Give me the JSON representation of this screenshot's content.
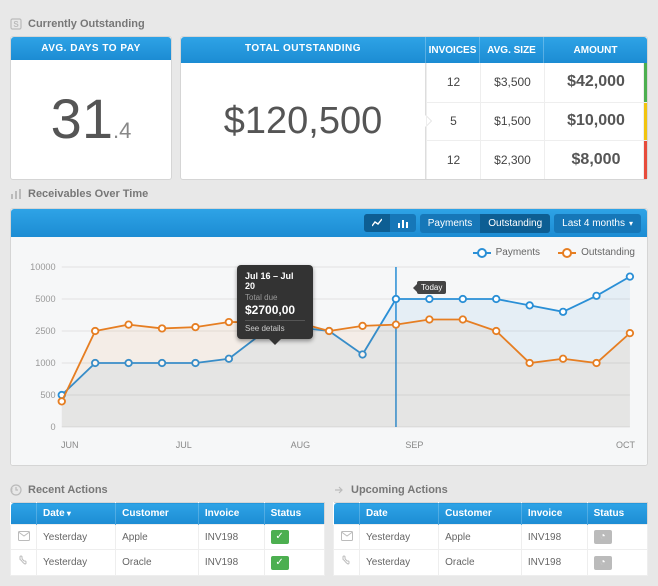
{
  "sections": {
    "outstanding_title": "Currently Outstanding",
    "receivables_title": "Receivables Over Time",
    "recent_title": "Recent Actions",
    "upcoming_title": "Upcoming Actions"
  },
  "avg_days": {
    "header": "AVG. DAYS TO PAY",
    "int": "31",
    "dec": ".4"
  },
  "total_outstanding": {
    "header": "TOTAL OUTSTANDING",
    "amount": "$120,500",
    "cols": {
      "invoices": "INVOICES",
      "avg_size": "AVG. SIZE",
      "amount": "AMOUNT"
    },
    "rows": [
      {
        "invoices": "12",
        "avg": "$3,500",
        "amount": "$42,000",
        "stripe": "#4caf50"
      },
      {
        "invoices": "5",
        "avg": "$1,500",
        "amount": "$10,000",
        "stripe": "#f1c40f"
      },
      {
        "invoices": "12",
        "avg": "$2,300",
        "amount": "$8,000",
        "stripe": "#e74c3c"
      }
    ]
  },
  "toolbar": {
    "btn_payments": "Payments",
    "btn_outstanding": "Outstanding",
    "range": "Last 4 months"
  },
  "legend": {
    "payments": "Payments",
    "outstanding": "Outstanding"
  },
  "tooltip": {
    "range": "Jul 16 – Jul 20",
    "label": "Total due",
    "value": "$2700,00",
    "link": "See details"
  },
  "today_label": "Today",
  "chart_data": {
    "type": "line",
    "xlabel": "",
    "ylabel": "",
    "y_ticks": [
      0,
      500,
      1000,
      2500,
      5000,
      10000
    ],
    "x_ticks": [
      "JUN",
      "JUL",
      "AUG",
      "SEP",
      "OCT"
    ],
    "x_domain_weeks": 17,
    "series": [
      {
        "name": "Payments",
        "color": "#2a8fd6",
        "values": [
          500,
          1000,
          1000,
          1000,
          1000,
          1200,
          2400,
          2800,
          2500,
          1400,
          5000,
          5000,
          5000,
          5000,
          4500,
          4000,
          5500,
          8500
        ]
      },
      {
        "name": "Outstanding",
        "color": "#e67e22",
        "values": [
          400,
          2500,
          3000,
          2700,
          2800,
          3200,
          3200,
          3200,
          2500,
          2900,
          3000,
          3400,
          3400,
          2500,
          1000,
          1200,
          1000,
          2400
        ]
      }
    ],
    "today_marker_index": 10,
    "tooltip_index": 7
  },
  "tables": {
    "cols": {
      "date": "Date",
      "customer": "Customer",
      "invoice": "Invoice",
      "status": "Status"
    },
    "recent": [
      {
        "icon": "mail",
        "date": "Yesterday",
        "customer": "Apple",
        "invoice": "INV198",
        "status": "ok"
      },
      {
        "icon": "phone",
        "date": "Yesterday",
        "customer": "Oracle",
        "invoice": "INV198",
        "status": "ok"
      }
    ],
    "upcoming": [
      {
        "icon": "mail",
        "date": "Yesterday",
        "customer": "Apple",
        "invoice": "INV198",
        "status": "clock"
      },
      {
        "icon": "phone",
        "date": "Yesterday",
        "customer": "Oracle",
        "invoice": "INV198",
        "status": "clock"
      }
    ]
  }
}
